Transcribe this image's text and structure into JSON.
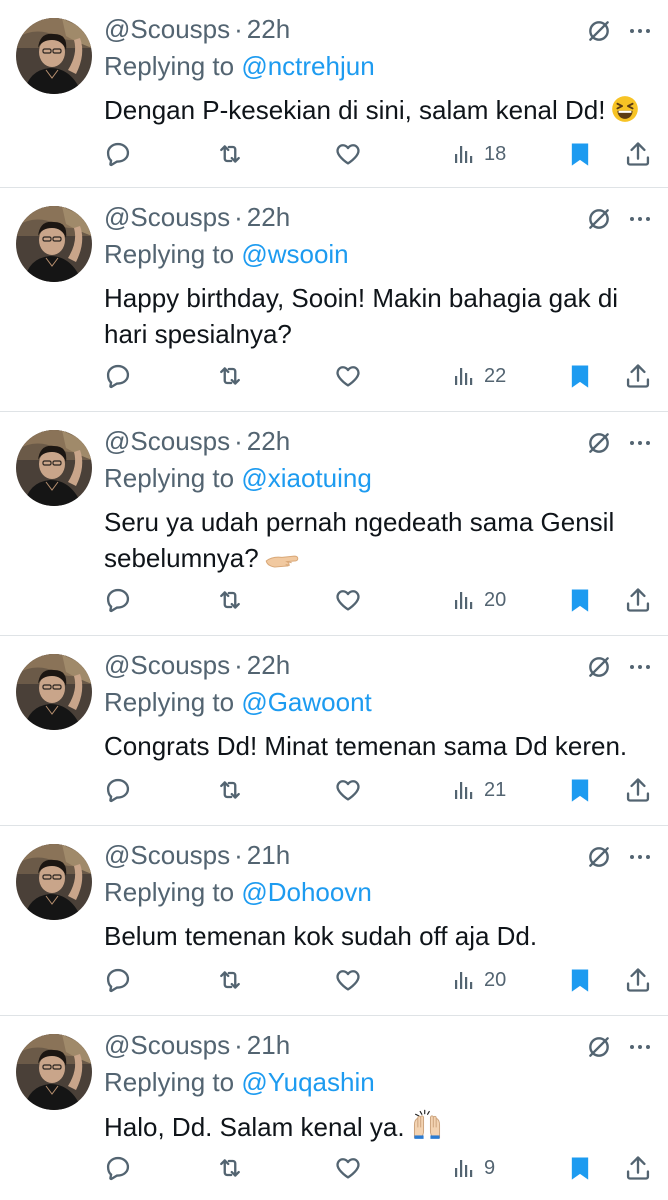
{
  "colors": {
    "accent": "#1d9bf0",
    "secondary_text": "#536471",
    "primary_text": "#0f1419",
    "divider": "#dfe3e6"
  },
  "labels": {
    "replying_to": "Replying to",
    "separator": "·"
  },
  "tweets": [
    {
      "handle": "@Scousps",
      "time": "22h",
      "reply_to": "@nctrehjun",
      "text": "Dengan P-kesekian di sini, salam kenal Dd!",
      "emoji_icon": "grinning-squinting-face-emoji",
      "views": "18"
    },
    {
      "handle": "@Scousps",
      "time": "22h",
      "reply_to": "@wsooin",
      "text": "Happy birthday, Sooin! Makin bahagia gak di hari spesialnya?",
      "views": "22"
    },
    {
      "handle": "@Scousps",
      "time": "22h",
      "reply_to": "@xiaotuing",
      "text": "Seru ya udah pernah ngedeath sama Gensil sebelumnya?",
      "emoji_icon": "palm-up-hand-emoji",
      "views": "20"
    },
    {
      "handle": "@Scousps",
      "time": "22h",
      "reply_to": "@Gawoont",
      "text": "Congrats Dd! Minat temenan sama Dd keren.",
      "views": "21"
    },
    {
      "handle": "@Scousps",
      "time": "21h",
      "reply_to": "@Dohoovn",
      "text": "Belum temenan kok sudah off aja Dd.",
      "views": "20"
    },
    {
      "handle": "@Scousps",
      "time": "21h",
      "reply_to": "@Yuqashin",
      "text": "Halo, Dd. Salam kenal ya.",
      "emoji_icon": "raising-hands-emoji",
      "views": "9"
    }
  ]
}
